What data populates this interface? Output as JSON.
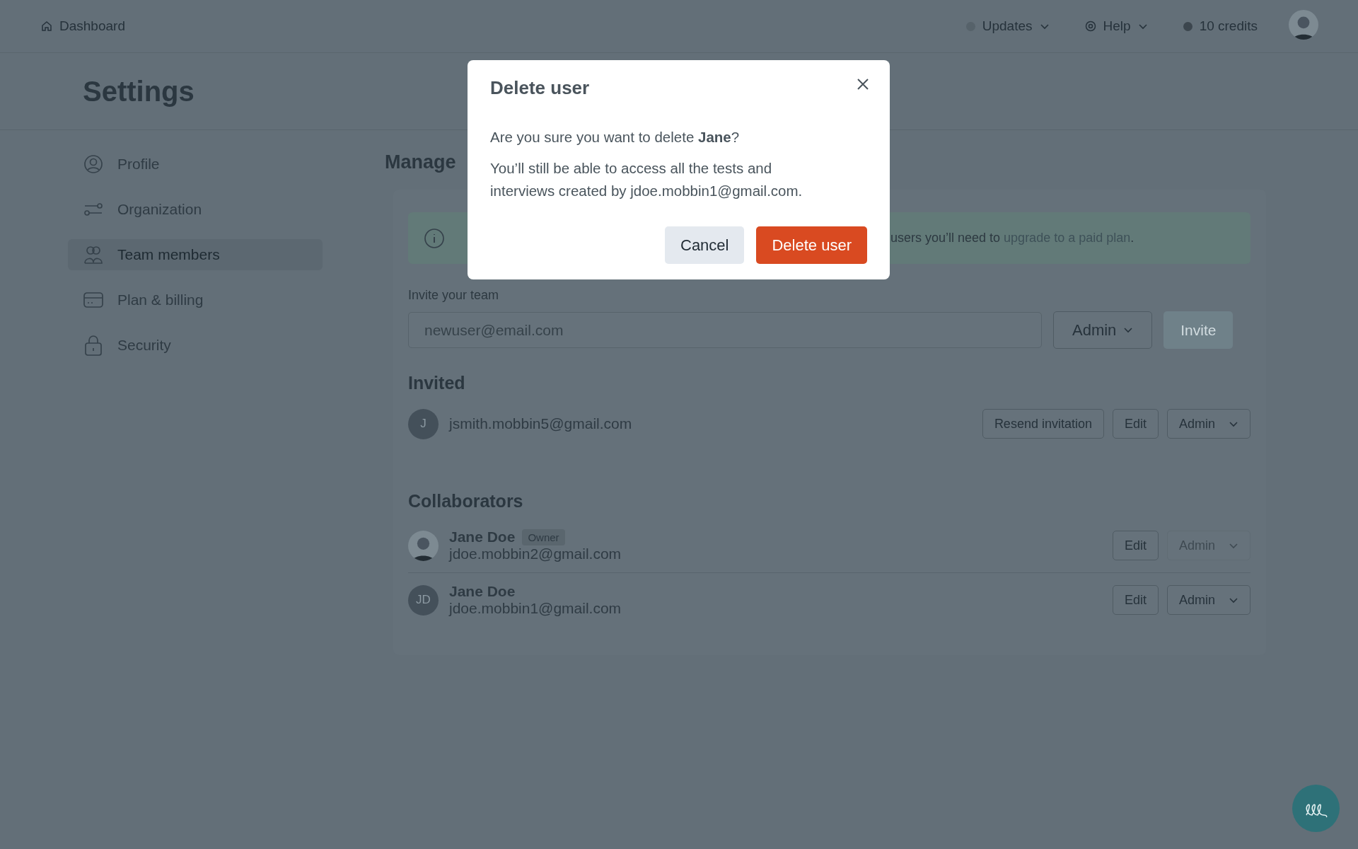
{
  "topbar": {
    "home_link": "Dashboard",
    "items": [
      {
        "label": "Updates",
        "kind": "status",
        "dropdown": true
      },
      {
        "label": "Help",
        "kind": "help",
        "dropdown": true
      },
      {
        "label": "10 credits",
        "kind": "credits",
        "dropdown": false
      }
    ]
  },
  "page_title": "Settings",
  "sidebar": {
    "items": [
      {
        "label": "Profile",
        "selected": false
      },
      {
        "label": "Organization",
        "selected": false
      },
      {
        "label": "Team members",
        "selected": true
      },
      {
        "label": "Plan & billing",
        "selected": false
      },
      {
        "label": "Security",
        "selected": false
      }
    ]
  },
  "main": {
    "heading": "Manage",
    "banner": {
      "text": "users you’ll need to ",
      "link": "upgrade to a paid plan",
      "end": "."
    },
    "invite": {
      "label": "Invite your team",
      "placeholder": "newuser@email.com",
      "role": "Admin",
      "button": {
        "label": "Invite",
        "disabled": true
      }
    },
    "invited": {
      "heading": "Invited",
      "rows": [
        {
          "photo": false,
          "initials": "J",
          "email": "jsmith.mobbin5@gmail.com",
          "actions": [
            "Resend invitation",
            "Edit"
          ],
          "role": "Admin",
          "role_disabled": false
        }
      ]
    },
    "collaborators": {
      "heading": "Collaborators",
      "rows": [
        {
          "photo": true,
          "name": "Jane Doe",
          "badge": "Owner",
          "email": "jdoe.mobbin2@gmail.com",
          "actions": [
            "Edit"
          ],
          "role": "Admin",
          "role_disabled": true
        },
        {
          "photo": false,
          "initials": "JD",
          "name": "Jane Doe",
          "email": "jdoe.mobbin1@gmail.com",
          "actions": [
            "Edit"
          ],
          "role": "Admin",
          "role_disabled": false
        }
      ]
    }
  },
  "modal": {
    "title": "Delete user",
    "question": "Are you sure you want to delete **Jane**?",
    "body": "You’ll still be able to access all the tests and interviews created by jdoe.mobbin1@gmail.com.",
    "cancel": "Cancel",
    "confirm": "Delete user"
  }
}
